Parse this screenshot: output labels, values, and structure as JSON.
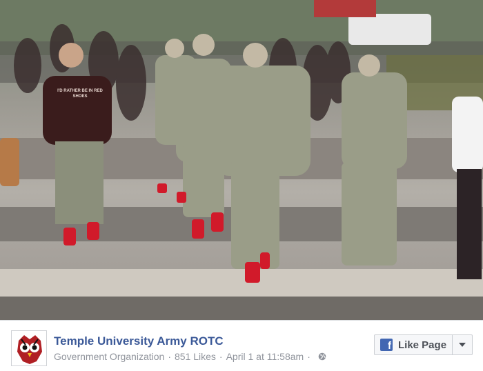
{
  "post": {
    "page_name": "Temple University Army ROTC",
    "category": "Government Organization",
    "likes": "851 Likes",
    "date": "April 1 at 11:58am",
    "separator": "·"
  },
  "actions": {
    "like_page_label": "Like Page",
    "fb_letter": "f"
  },
  "photo": {
    "shirt_text": "I'D RATHER BE IN RED SHOES"
  },
  "colors": {
    "link": "#3b5998",
    "meta": "#90949c",
    "fb_blue": "#4267b2"
  },
  "icons": {
    "avatar": "owl-logo-icon",
    "privacy": "globe-icon",
    "brand": "facebook-icon",
    "menu": "chevron-down-icon"
  }
}
